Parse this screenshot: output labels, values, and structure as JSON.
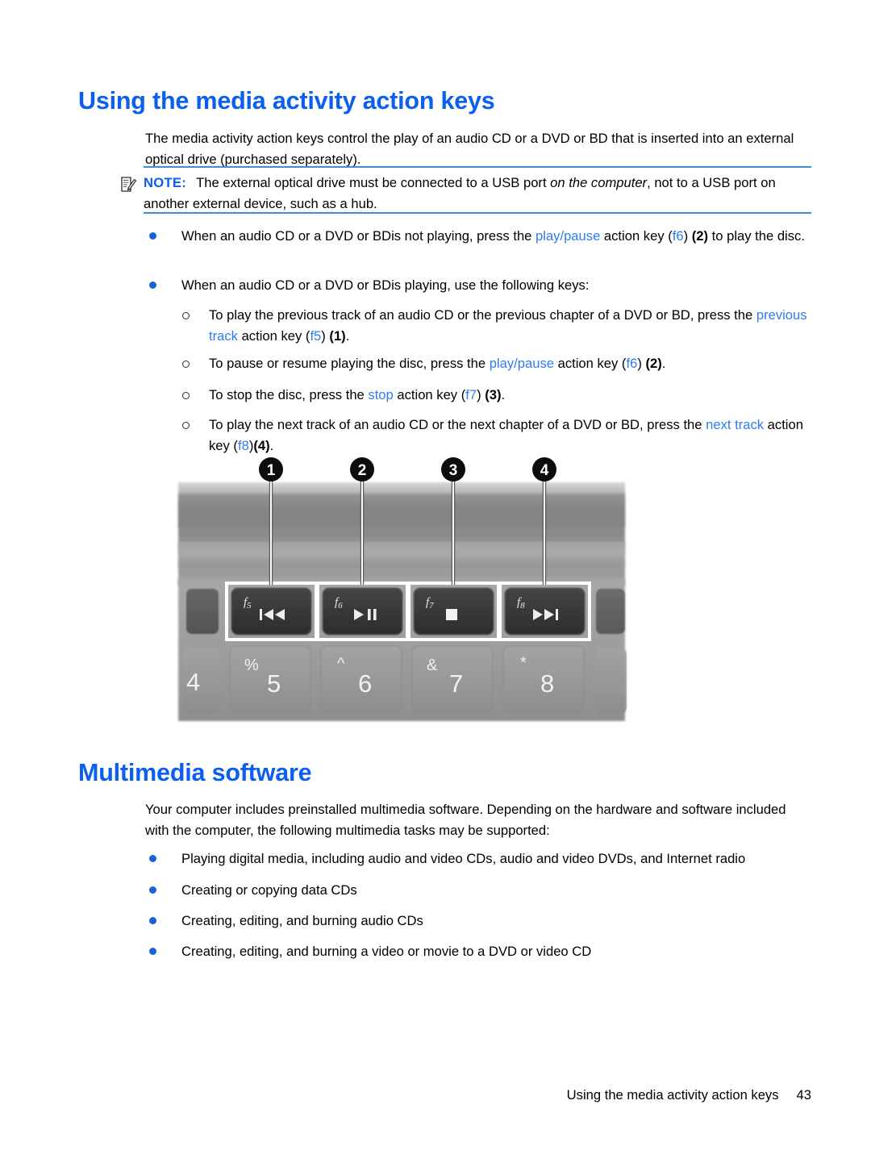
{
  "document": {
    "type": "user-guide-page",
    "accent_color": "#0a5ef0",
    "link_color": "#2f7bf0",
    "rule_color": "#3d8ddf"
  },
  "sections": {
    "media_keys": {
      "heading": "Using the media activity action keys",
      "intro": "The media activity action keys control the play of an audio CD or a DVD or BD that is inserted into an external optical drive (purchased separately).",
      "note": {
        "icon": "note-pencil-icon",
        "label": "NOTE:",
        "text_1": "The external optical drive must be connected to a USB port ",
        "text_italic": "on the computer",
        "text_2": ", not to a USB port on another external device, such as a hub."
      },
      "bullets": [
        {
          "level": 1,
          "parts": [
            {
              "t": "When an audio CD or a DVD or BDis not playing, press the ",
              "s": "plain"
            },
            {
              "t": "play/pause",
              "s": "blue"
            },
            {
              "t": " action key (",
              "s": "plain"
            },
            {
              "t": "f6",
              "s": "blue"
            },
            {
              "t": ") ",
              "s": "plain"
            },
            {
              "t": "(2)",
              "s": "bold"
            },
            {
              "t": " to play the disc.",
              "s": "plain"
            }
          ]
        },
        {
          "level": 1,
          "parts": [
            {
              "t": "When an audio CD or a DVD or BDis playing, use the following keys:",
              "s": "plain"
            }
          ]
        },
        {
          "level": 2,
          "parts": [
            {
              "t": "To play the previous track of an audio CD or the previous chapter of a DVD or BD, press the ",
              "s": "plain"
            },
            {
              "t": "previous track",
              "s": "blue"
            },
            {
              "t": " action key (",
              "s": "plain"
            },
            {
              "t": "f5",
              "s": "blue"
            },
            {
              "t": ") ",
              "s": "plain"
            },
            {
              "t": "(1)",
              "s": "bold"
            },
            {
              "t": ".",
              "s": "plain"
            }
          ]
        },
        {
          "level": 2,
          "parts": [
            {
              "t": "To pause or resume playing the disc, press the ",
              "s": "plain"
            },
            {
              "t": "play/pause",
              "s": "blue"
            },
            {
              "t": " action key (",
              "s": "plain"
            },
            {
              "t": "f6",
              "s": "blue"
            },
            {
              "t": ") ",
              "s": "plain"
            },
            {
              "t": "(2)",
              "s": "bold"
            },
            {
              "t": ".",
              "s": "plain"
            }
          ]
        },
        {
          "level": 2,
          "parts": [
            {
              "t": "To stop the disc, press the ",
              "s": "plain"
            },
            {
              "t": "stop",
              "s": "blue"
            },
            {
              "t": " action key (",
              "s": "plain"
            },
            {
              "t": "f7",
              "s": "blue"
            },
            {
              "t": ") ",
              "s": "plain"
            },
            {
              "t": "(3)",
              "s": "bold"
            },
            {
              "t": ".",
              "s": "plain"
            }
          ]
        },
        {
          "level": 2,
          "parts": [
            {
              "t": "To play the next track of an audio CD or the next chapter of a DVD or BD, press the ",
              "s": "plain"
            },
            {
              "t": "next track",
              "s": "blue"
            },
            {
              "t": " action key (",
              "s": "plain"
            },
            {
              "t": "f8",
              "s": "blue"
            },
            {
              "t": ")",
              "s": "plain"
            },
            {
              "t": "(4)",
              "s": "bold"
            },
            {
              "t": ".",
              "s": "plain"
            }
          ]
        }
      ]
    },
    "multimedia_software": {
      "heading": "Multimedia software",
      "intro": "Your computer includes preinstalled multimedia software. Depending on the hardware and software included with the computer, the following multimedia tasks may be supported:",
      "bullets": [
        "Playing digital media, including audio and video CDs, audio and video DVDs, and Internet radio",
        "Creating or copying data CDs",
        "Creating, editing, and burning audio CDs",
        "Creating, editing, and burning a video or movie to a DVD or video CD"
      ]
    }
  },
  "figure": {
    "description": "Close-up photo of a laptop keyboard showing the f5-f8 media action keys with numbered callouts",
    "callouts": [
      {
        "number": "1",
        "key": "f5",
        "glyph": "previous-track-icon"
      },
      {
        "number": "2",
        "key": "f6",
        "glyph": "play-pause-icon"
      },
      {
        "number": "3",
        "key": "f7",
        "glyph": "stop-icon"
      },
      {
        "number": "4",
        "key": "f8",
        "glyph": "next-track-icon"
      }
    ],
    "function_keys": [
      {
        "label": "f5",
        "icon": "previous-track-icon"
      },
      {
        "label": "f6",
        "icon": "play-pause-icon"
      },
      {
        "label": "f7",
        "icon": "stop-icon"
      },
      {
        "label": "f8",
        "icon": "next-track-icon"
      }
    ],
    "number_row_keys": [
      {
        "primary": "4",
        "shift": ""
      },
      {
        "primary": "5",
        "shift": "%"
      },
      {
        "primary": "6",
        "shift": "^"
      },
      {
        "primary": "7",
        "shift": "&"
      },
      {
        "primary": "8",
        "shift": "*"
      }
    ]
  },
  "footer": {
    "running_title": "Using the media activity action keys",
    "page_number": "43"
  }
}
